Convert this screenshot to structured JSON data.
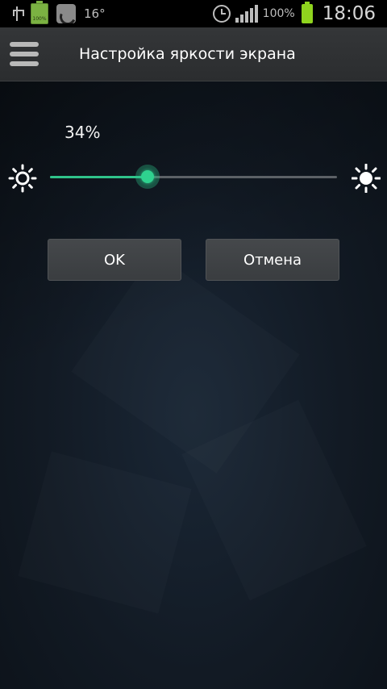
{
  "status_bar": {
    "battery_small_label": "100%",
    "temperature": "16°",
    "battery_percent": "100%",
    "time": "18:06",
    "icons": [
      "usb-icon",
      "battery-small-icon",
      "satellite-icon",
      "alarm-icon",
      "signal-icon",
      "battery-icon"
    ]
  },
  "header": {
    "menu_icon": "hamburger-menu-icon",
    "title": "Настройка яркости экрана"
  },
  "brightness": {
    "percent_label": "34%",
    "value": 0.34,
    "min_icon": "sun-dim-icon",
    "max_icon": "sun-bright-icon"
  },
  "buttons": {
    "ok_label": "OK",
    "cancel_label": "Отмена"
  },
  "colors": {
    "accent": "#2fc38a",
    "titlebar": "#2f3133",
    "background": "#121a24"
  }
}
